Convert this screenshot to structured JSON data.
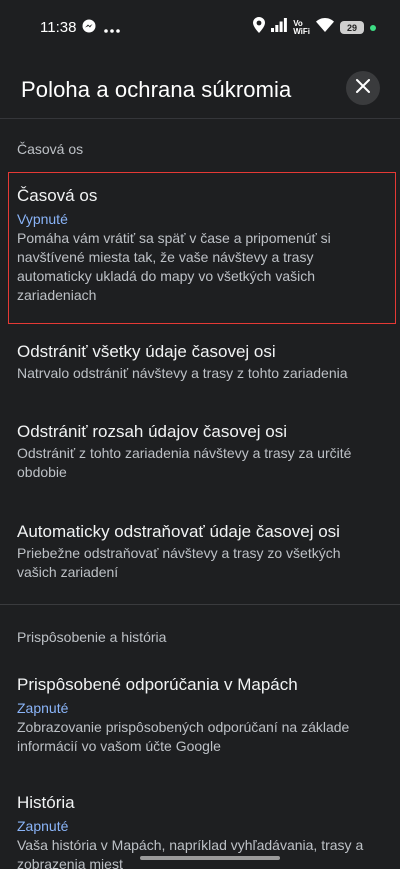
{
  "status_bar": {
    "time": "11:38",
    "battery_level": "29",
    "vowifi_top": "Vo",
    "vowifi_bottom": "WiFi",
    "icons": [
      "messenger-icon",
      "more-dots-icon",
      "location-icon",
      "signal-icon",
      "wifi-icon",
      "battery-icon"
    ]
  },
  "header": {
    "title": "Poloha a ochrana súkromia",
    "close_icon": "close-icon"
  },
  "sections": [
    {
      "header": "Časová os",
      "items": [
        {
          "title": "Časová os",
          "status": "Vypnuté",
          "description": "Pomáha vám vrátiť sa späť v čase a pripomenúť si navštívené miesta tak, že vaše návštevy a trasy automaticky ukladá do mapy vo všetkých vašich zariadeniach"
        },
        {
          "title": "Odstrániť všetky údaje časovej osi",
          "description": "Natrvalo odstrániť návštevy a trasy z tohto zariadenia"
        },
        {
          "title": "Odstrániť rozsah údajov časovej osi",
          "description": "Odstrániť z tohto zariadenia návštevy a trasy za určité obdobie"
        },
        {
          "title": "Automaticky odstraňovať údaje časovej osi",
          "description": "Priebežne odstraňovať návštevy a trasy zo všetkých vašich zariadení"
        }
      ]
    },
    {
      "header": "Prispôsobenie a história",
      "items": [
        {
          "title": "Prispôsobené odporúčania v Mapách",
          "status": "Zapnuté",
          "description": "Zobrazovanie prispôsobených odporúčaní na základe informácií vo vašom účte Google"
        },
        {
          "title": "História",
          "status": "Zapnuté",
          "description": "Vaša história v Mapách, napríklad vyhľadávania, trasy a zobrazenia miest"
        }
      ]
    }
  ],
  "colors": {
    "background": "#1e1f21",
    "accent_blue": "#8ab4f8",
    "highlight_red": "#e53935"
  }
}
